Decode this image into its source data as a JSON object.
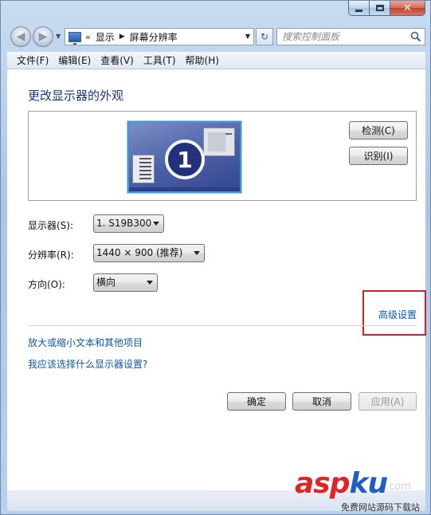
{
  "window": {
    "close_glyph": "✕"
  },
  "nav": {
    "back_glyph": "◀",
    "forward_glyph": "▶",
    "address_sep": "«",
    "address_path": [
      "显示",
      "屏幕分辨率"
    ],
    "address_tri": "▶",
    "refresh_glyph": "↻",
    "search_placeholder": "搜索控制面板",
    "icons": [
      "back-arrow-icon",
      "forward-arrow-icon",
      "control-panel-icon",
      "refresh-icon",
      "search-icon"
    ]
  },
  "menu": [
    "文件(F)",
    "编辑(E)",
    "查看(V)",
    "工具(T)",
    "帮助(H)"
  ],
  "main": {
    "title": "更改显示器的外观",
    "monitor_number": "1",
    "detect_label": "检测(C)",
    "identify_label": "识别(I)",
    "display_label": "显示器(S):",
    "display_value": "1. S19B300",
    "resolution_label": "分辨率(R):",
    "resolution_value": "1440 × 900 (推荐)",
    "orientation_label": "方向(O):",
    "orientation_value": "横向",
    "advanced_link": "高级设置",
    "text_size_link": "放大或缩小文本和其他项目",
    "help_link": "我应该选择什么显示器设置?",
    "ok_label": "确定",
    "cancel_label": "取消",
    "apply_label": "应用(A)"
  },
  "watermark": {
    "asp": "asp",
    "ku": "ku",
    "tail": ".com",
    "sub": "免费网站源码下载站"
  },
  "colors": {
    "link": "#0b58a8",
    "title": "#1e3287",
    "highlight": "#d6202a",
    "monitor_border": "#3f97d6"
  }
}
